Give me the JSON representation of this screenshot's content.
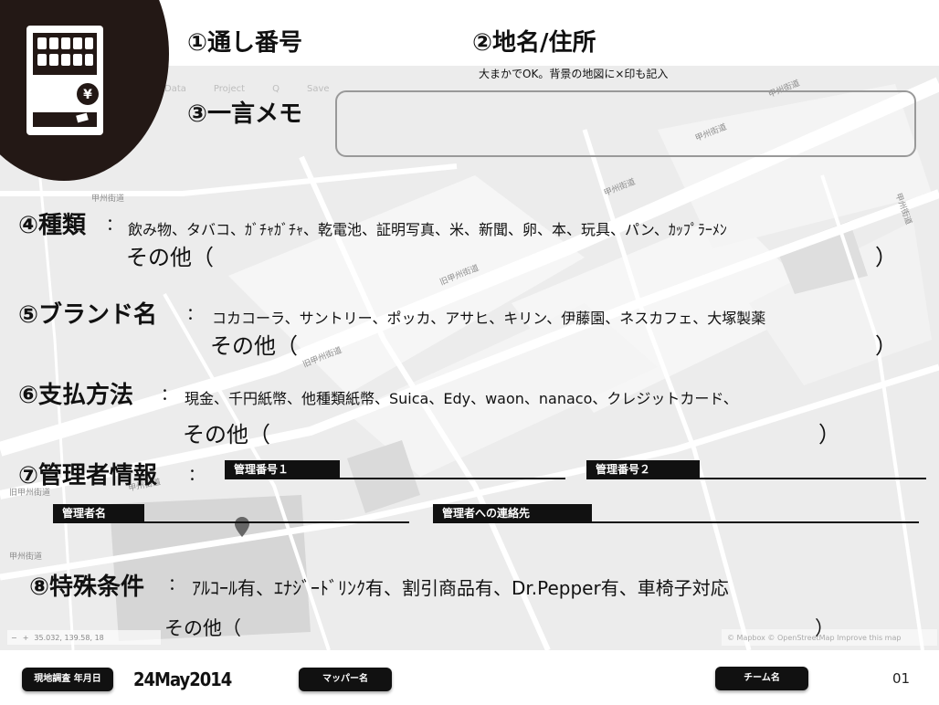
{
  "map": {
    "toolbar": [
      "Data",
      "Project",
      "Q",
      "Save"
    ],
    "roads": [
      "甲州街道",
      "甲州街道",
      "甲州街道",
      "旧甲州街道",
      "旧甲州街道",
      "甲州街道",
      "甲州街道",
      "甲州街道",
      "旧甲州街道",
      "甲州街道"
    ],
    "coords": "35.032, 139.58, 18",
    "attribution": "© Mapbox © OpenStreetMap Improve this map",
    "colors": {
      "background": "#ececec",
      "block": "#f7f7f7",
      "road": "#ffffff",
      "dark": "#cfcfcf"
    }
  },
  "logo": {
    "icon": "vending-machine-icon",
    "color": "#231815"
  },
  "fields": {
    "serial": "①通し番号",
    "place": "②地名/住所",
    "place_note": "大まかでOK。背景の地図に×印も記入",
    "memo": "③一言メモ",
    "kind": {
      "label": "④種類",
      "colon": "：",
      "options": "飲み物、タバコ、ｶﾞﾁｬｶﾞﾁｬ、乾電池、証明写真、米、新聞、卵、本、玩具、パン、ｶｯﾌﾟﾗｰﾒﾝ",
      "other": "その他（",
      "close": "）"
    },
    "brand": {
      "label": "⑤ブランド名",
      "colon": "：",
      "options": "コカコーラ、サントリー、ポッカ、アサヒ、キリン、伊藤園、ネスカフェ、大塚製薬",
      "other": "その他（",
      "close": "）"
    },
    "payment": {
      "label": "⑥支払方法",
      "colon": "：",
      "options": "現金、千円紙幣、他種類紙幣、Suica、Edy、waon、nanaco、クレジットカード、",
      "other": "その他（",
      "close": "）"
    },
    "manager": {
      "label": "⑦管理者情報",
      "colon": "：",
      "number1": "管理番号１",
      "number2": "管理番号２",
      "name": "管理者名",
      "contact": "管理者への連絡先"
    },
    "special": {
      "label": "⑧特殊条件",
      "colon": "：",
      "options": "ｱﾙｺｰﾙ有、ｴﾅｼﾞｰﾄﾞﾘﾝｸ有、割引商品有、Dr.Pepper有、車椅子対応",
      "other": "その他（",
      "close": "）"
    }
  },
  "footer": {
    "survey_date_label": "現地調査 年月日",
    "date": "24May2014",
    "mapper_label": "マッパー名",
    "team_label": "チーム名",
    "page": "01"
  }
}
